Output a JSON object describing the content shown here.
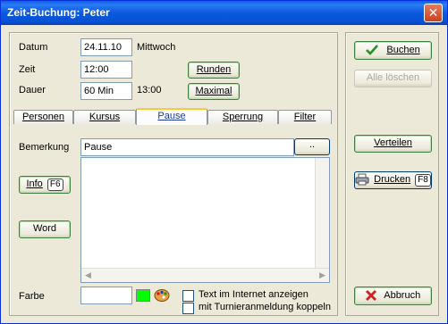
{
  "window": {
    "title": "Zeit-Buchung: Peter",
    "close_symbol": "✕"
  },
  "form": {
    "datum_label": "Datum",
    "datum_value": "24.11.10",
    "weekday": "Mittwoch",
    "zeit_label": "Zeit",
    "zeit_value": "12:00",
    "dauer_label": "Dauer",
    "dauer_value": "60 Min",
    "end_time": "13:00",
    "runden_label": "Runden",
    "maximal_label": "Maximal"
  },
  "tabs": [
    {
      "label": "Personen"
    },
    {
      "label": "Kursus"
    },
    {
      "label": "Pause"
    },
    {
      "label": "Sperrung"
    },
    {
      "label": "Filter"
    }
  ],
  "active_tab": "Pause",
  "bemerkung": {
    "label": "Bemerkung",
    "value": "Pause",
    "picker_label": "..",
    "memo_text": ""
  },
  "left_buttons": {
    "info_label": "Info",
    "info_key": "F6",
    "word_label": "Word"
  },
  "farbe": {
    "label": "Farbe",
    "value": "",
    "swatch_color": "#00ff00"
  },
  "checkboxes": [
    {
      "label": "Text im Internet anzeigen",
      "checked": false
    },
    {
      "label": "mit Turnieranmeldung koppeln",
      "checked": false
    }
  ],
  "side_buttons": {
    "buchen_label": "Buchen",
    "alle_loeschen_label": "Alle löschen",
    "verteilen_label": "Verteilen",
    "drucken_label": "Drucken",
    "drucken_key": "F8",
    "abbruch_label": "Abbruch"
  },
  "colors": {
    "titlebar": "#0a5fe8",
    "face": "#ece9d8",
    "ok_check": "#2a8f2a",
    "cancel_x": "#d02020"
  }
}
